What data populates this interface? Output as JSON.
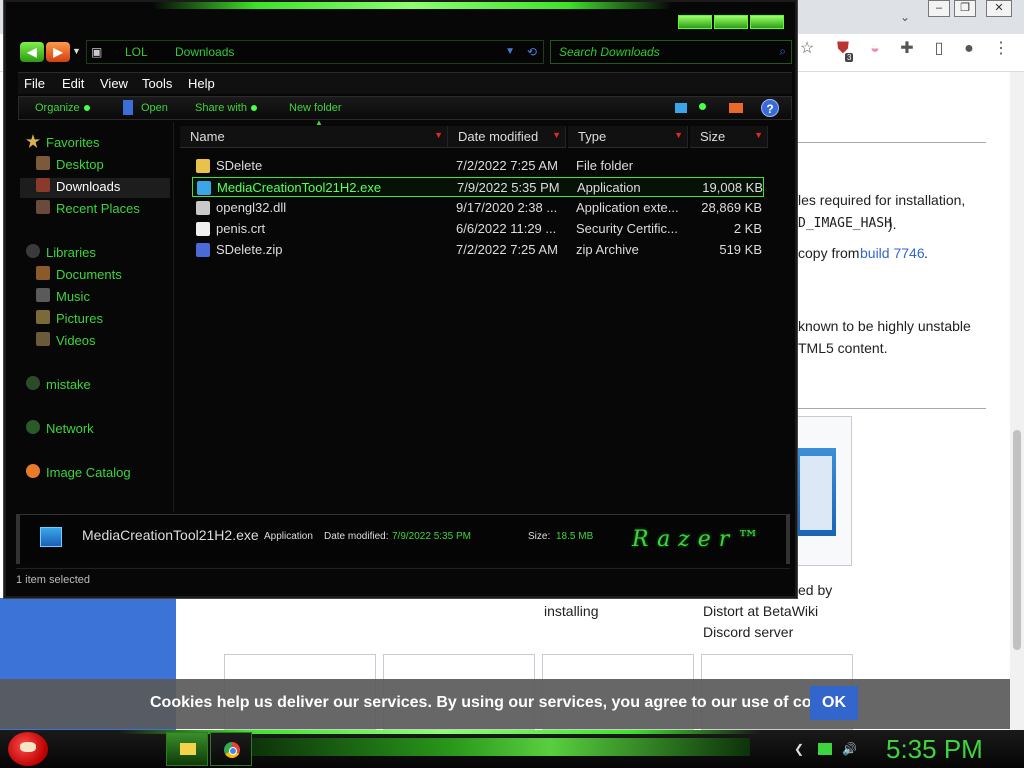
{
  "browser": {
    "window_controls": [
      "–",
      "❐",
      "✕"
    ],
    "toolbar_icons": [
      "star-icon",
      "shield-extension-icon",
      "flag-extension-icon",
      "puzzle-icon",
      "sidebar-icon",
      "profile-icon",
      "menu-icon"
    ],
    "extension_badge": "3",
    "article_lines": [
      "les required for installation,",
      "D_IMAGE_HASH",
      " ).",
      "copy from ",
      "build 7746",
      ".",
      " known to be highly unstable",
      "TML5 content."
    ],
    "captions": [
      "installing",
      "Distort at BetaWiki",
      "Discord server",
      "ed by"
    ]
  },
  "explorer": {
    "address": {
      "crumbs": [
        "LOL",
        "Downloads"
      ],
      "search_placeholder": "Search Downloads"
    },
    "menu": [
      "File",
      "Edit",
      "View",
      "Tools",
      "Help"
    ],
    "commands": {
      "organize": "Organize",
      "open": "Open",
      "share_with": "Share with",
      "new_folder": "New folder"
    },
    "nav": {
      "favorites": "Favorites",
      "desktop": "Desktop",
      "downloads": "Downloads",
      "recent_places": "Recent Places",
      "libraries": "Libraries",
      "documents": "Documents",
      "music": "Music",
      "pictures": "Pictures",
      "videos": "Videos",
      "mistake": "mistake",
      "network": "Network",
      "image_catalog": "Image Catalog"
    },
    "columns": {
      "name": "Name",
      "date_modified": "Date modified",
      "type": "Type",
      "size": "Size"
    },
    "files": [
      {
        "name": "SDelete",
        "date": "7/2/2022 7:25 AM",
        "type": "File folder",
        "size": ""
      },
      {
        "name": "MediaCreationTool21H2.exe",
        "date": "7/9/2022 5:35 PM",
        "type": "Application",
        "size": "19,008 KB"
      },
      {
        "name": "opengl32.dll",
        "date": "9/17/2020 2:38 ...",
        "type": "Application exte...",
        "size": "28,869 KB"
      },
      {
        "name": "penis.crt",
        "date": "6/6/2022 11:29 ...",
        "type": "Security Certific...",
        "size": "2 KB"
      },
      {
        "name": "SDelete.zip",
        "date": "7/2/2022 7:25 AM",
        "type": "zip Archive",
        "size": "519 KB"
      }
    ],
    "details": {
      "name": "MediaCreationTool21H2.exe",
      "type": "Application",
      "date_label": "Date modified:",
      "date_value": "7/9/2022 5:35 PM",
      "size_label": "Size:",
      "size_value": "18.5 MB",
      "brand": "Razer™"
    },
    "status": "1 item selected"
  },
  "cookie": {
    "text": "Cookies help us deliver our services. By using our services, you agree to our use of cookies.",
    "ok": "OK"
  },
  "taskbar": {
    "clock": "5:35 PM"
  },
  "colors": {
    "accent_green": "#3ed43e",
    "banner_blue": "#3366cc"
  }
}
